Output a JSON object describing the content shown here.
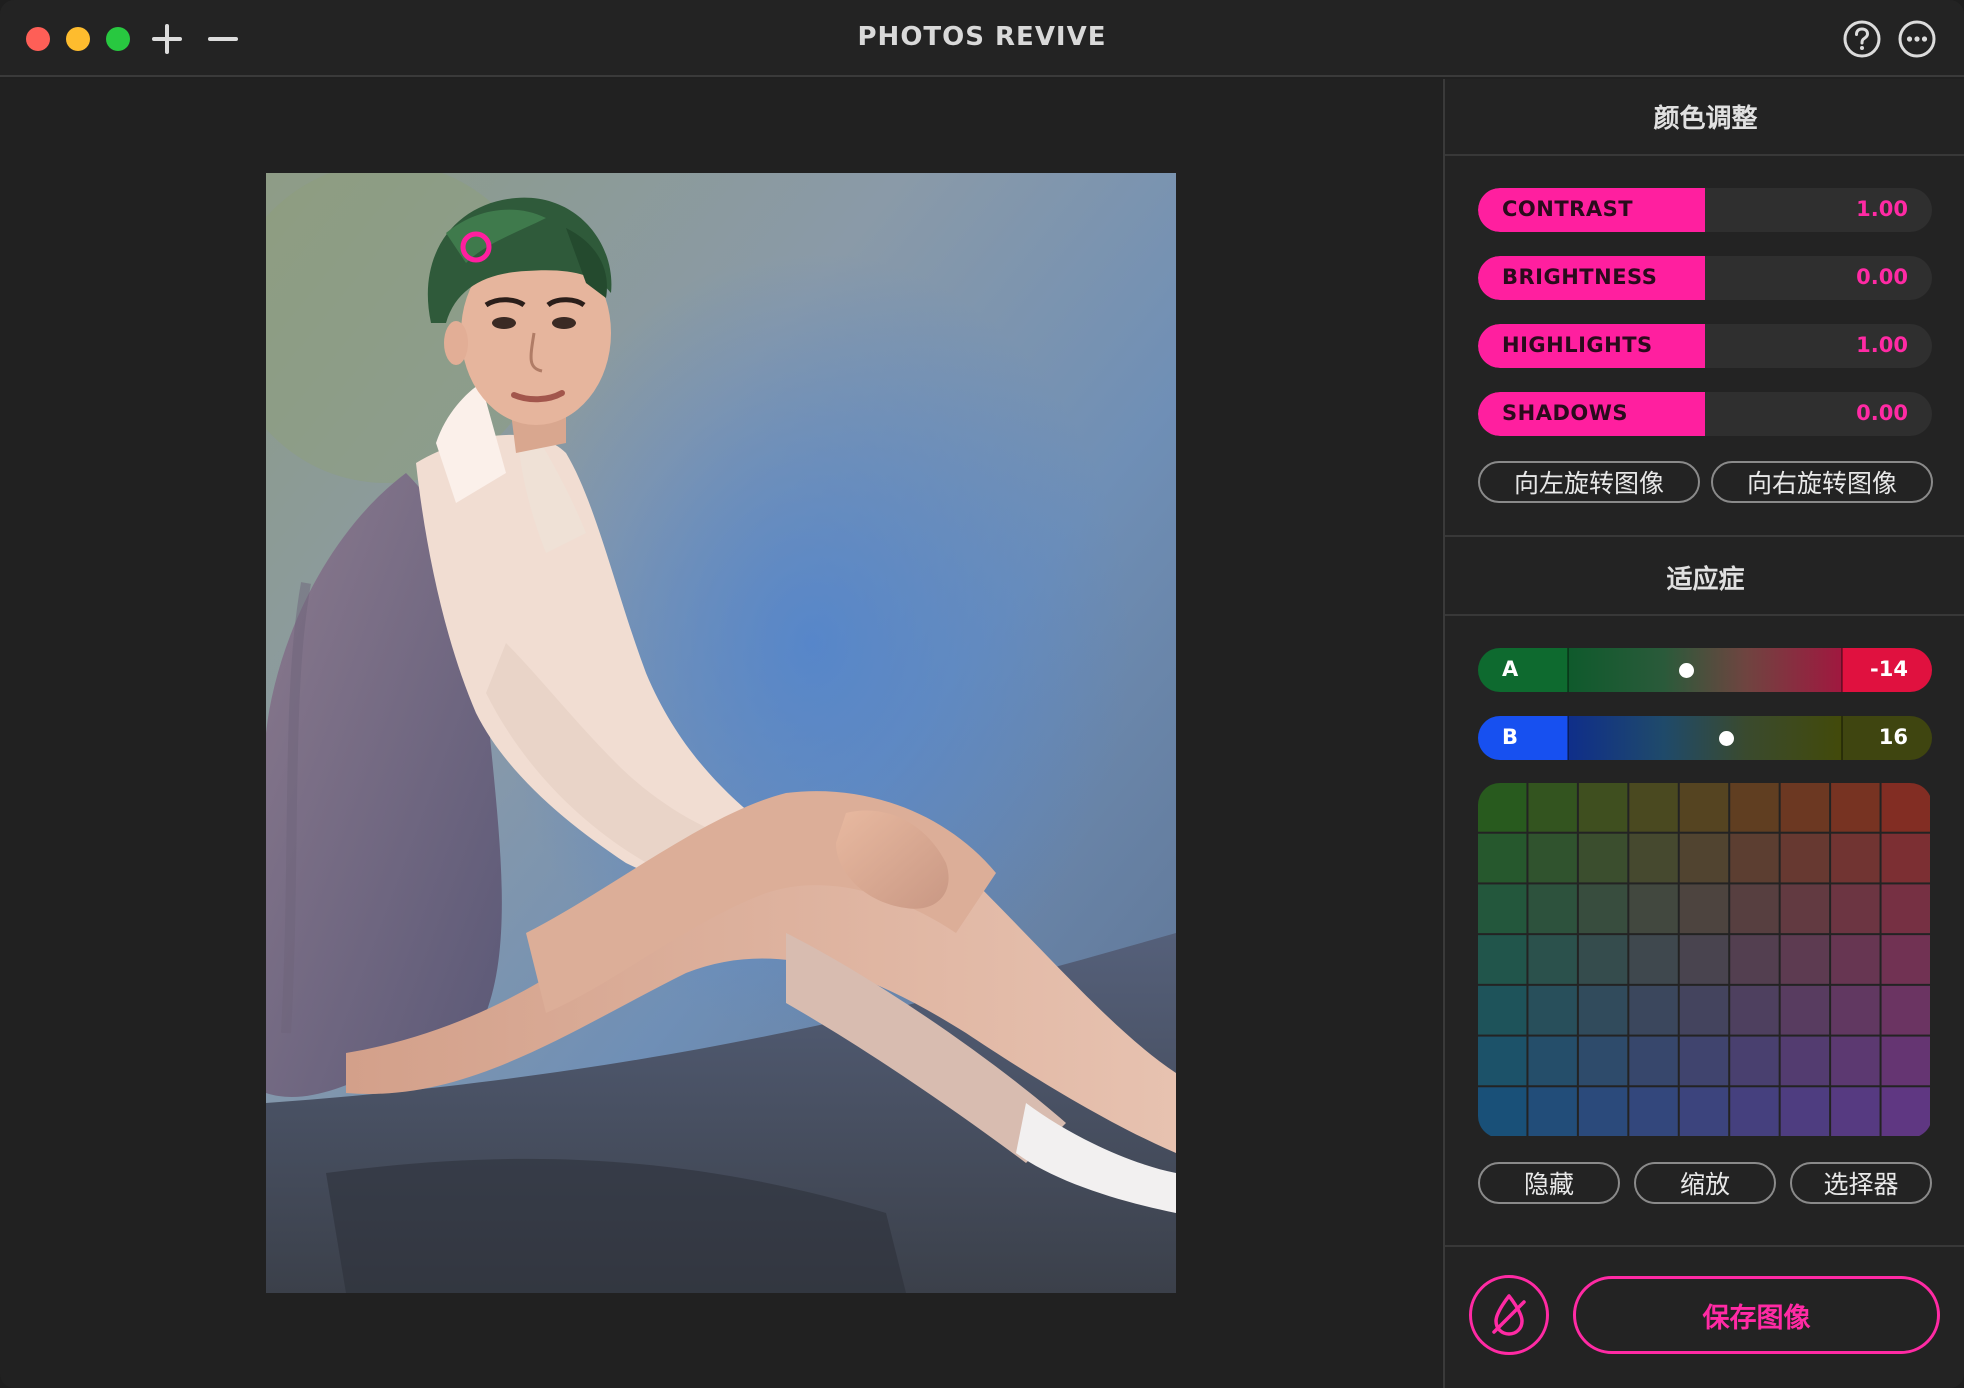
{
  "window": {
    "title": "PHOTOS REVIVE"
  },
  "toolbar": {
    "add_icon": "plus-icon",
    "remove_icon": "minus-icon",
    "help_icon": "question-circle-icon",
    "more_icon": "ellipsis-circle-icon"
  },
  "colors": {
    "accent": "#ff1f9f",
    "panel_bg": "#232323",
    "canvas_bg": "#212121"
  },
  "color_adjust": {
    "title": "颜色调整",
    "sliders": [
      {
        "label": "CONTRAST",
        "value": "1.00",
        "level": 0.5
      },
      {
        "label": "BRIGHTNESS",
        "value": "0.00",
        "level": 0.5
      },
      {
        "label": "HIGHLIGHTS",
        "value": "1.00",
        "level": 0.5
      },
      {
        "label": "SHADOWS",
        "value": "0.00",
        "level": 0.5
      }
    ],
    "rotate_left": "向左旋转图像",
    "rotate_right": "向右旋转图像"
  },
  "adaptation": {
    "title": "适应症",
    "a": {
      "name": "A",
      "value": "-14",
      "level": 0.43
    },
    "b": {
      "name": "B",
      "value": "16",
      "level": 0.58
    },
    "hide": "隐藏",
    "zoom": "缩放",
    "picker": "选择器"
  },
  "footer": {
    "color_drop_icon": "droplet-slash-icon",
    "save": "保存图像"
  }
}
